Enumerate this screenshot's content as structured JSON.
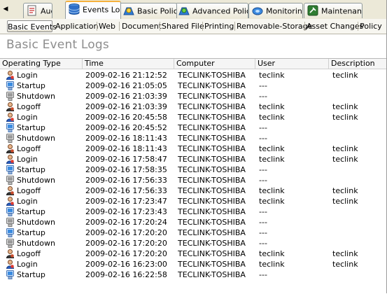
{
  "tabs": [
    {
      "id": "audit",
      "label": "Audit",
      "icon": "audit-icon"
    },
    {
      "id": "events",
      "label": "Events Log",
      "icon": "events-log-icon",
      "active": true
    },
    {
      "id": "basic",
      "label": "Basic Policy",
      "icon": "basic-policy-icon"
    },
    {
      "id": "advanced",
      "label": "Advanced Policy",
      "icon": "advanced-policy-icon"
    },
    {
      "id": "monitoring",
      "label": "Monitoring",
      "icon": "monitoring-icon"
    },
    {
      "id": "maintenance",
      "label": "Maintenance",
      "icon": "maintenance-icon"
    }
  ],
  "subtabs": [
    "Basic Events",
    "Application",
    "Web",
    "Document",
    "Shared File",
    "Printing",
    "Removable-Storage",
    "Asset Changes",
    "Policy"
  ],
  "page_title": "Basic Event Logs",
  "table": {
    "columns": [
      "Operating Type",
      "Time",
      "Computer",
      "User",
      "Description"
    ],
    "rows": [
      {
        "type": "Login",
        "icon": "login-icon",
        "time": "2009-02-16 21:12:52",
        "computer": "TECLINK-TOSHIBA",
        "user": "teclink",
        "description": "teclink"
      },
      {
        "type": "Startup",
        "icon": "startup-icon",
        "time": "2009-02-16 21:05:05",
        "computer": "TECLINK-TOSHIBA",
        "user": "---",
        "description": ""
      },
      {
        "type": "Shutdown",
        "icon": "shutdown-icon",
        "time": "2009-02-16 21:03:39",
        "computer": "TECLINK-TOSHIBA",
        "user": "---",
        "description": ""
      },
      {
        "type": "Logoff",
        "icon": "logoff-icon",
        "time": "2009-02-16 21:03:39",
        "computer": "TECLINK-TOSHIBA",
        "user": "teclink",
        "description": "teclink"
      },
      {
        "type": "Login",
        "icon": "login-icon",
        "time": "2009-02-16 20:45:58",
        "computer": "TECLINK-TOSHIBA",
        "user": "teclink",
        "description": "teclink"
      },
      {
        "type": "Startup",
        "icon": "startup-icon",
        "time": "2009-02-16 20:45:52",
        "computer": "TECLINK-TOSHIBA",
        "user": "---",
        "description": ""
      },
      {
        "type": "Shutdown",
        "icon": "shutdown-icon",
        "time": "2009-02-16 18:11:43",
        "computer": "TECLINK-TOSHIBA",
        "user": "---",
        "description": ""
      },
      {
        "type": "Logoff",
        "icon": "logoff-icon",
        "time": "2009-02-16 18:11:43",
        "computer": "TECLINK-TOSHIBA",
        "user": "teclink",
        "description": "teclink"
      },
      {
        "type": "Login",
        "icon": "login-icon",
        "time": "2009-02-16 17:58:47",
        "computer": "TECLINK-TOSHIBA",
        "user": "teclink",
        "description": "teclink"
      },
      {
        "type": "Startup",
        "icon": "startup-icon",
        "time": "2009-02-16 17:58:35",
        "computer": "TECLINK-TOSHIBA",
        "user": "---",
        "description": ""
      },
      {
        "type": "Shutdown",
        "icon": "shutdown-icon",
        "time": "2009-02-16 17:56:33",
        "computer": "TECLINK-TOSHIBA",
        "user": "---",
        "description": ""
      },
      {
        "type": "Logoff",
        "icon": "logoff-icon",
        "time": "2009-02-16 17:56:33",
        "computer": "TECLINK-TOSHIBA",
        "user": "teclink",
        "description": "teclink"
      },
      {
        "type": "Login",
        "icon": "login-icon",
        "time": "2009-02-16 17:23:47",
        "computer": "TECLINK-TOSHIBA",
        "user": "teclink",
        "description": "teclink"
      },
      {
        "type": "Startup",
        "icon": "startup-icon",
        "time": "2009-02-16 17:23:43",
        "computer": "TECLINK-TOSHIBA",
        "user": "---",
        "description": ""
      },
      {
        "type": "Shutdown",
        "icon": "shutdown-icon",
        "time": "2009-02-16 17:20:24",
        "computer": "TECLINK-TOSHIBA",
        "user": "---",
        "description": ""
      },
      {
        "type": "Startup",
        "icon": "startup-icon",
        "time": "2009-02-16 17:20:20",
        "computer": "TECLINK-TOSHIBA",
        "user": "---",
        "description": ""
      },
      {
        "type": "Shutdown",
        "icon": "shutdown-icon",
        "time": "2009-02-16 17:20:20",
        "computer": "TECLINK-TOSHIBA",
        "user": "---",
        "description": ""
      },
      {
        "type": "Logoff",
        "icon": "logoff-icon",
        "time": "2009-02-16 17:20:20",
        "computer": "TECLINK-TOSHIBA",
        "user": "teclink",
        "description": "teclink"
      },
      {
        "type": "Login",
        "icon": "login-icon",
        "time": "2009-02-16 16:23:00",
        "computer": "TECLINK-TOSHIBA",
        "user": "teclink",
        "description": "teclink"
      },
      {
        "type": "Startup",
        "icon": "startup-icon",
        "time": "2009-02-16 16:22:58",
        "computer": "TECLINK-TOSHIBA",
        "user": "---",
        "description": ""
      }
    ]
  }
}
